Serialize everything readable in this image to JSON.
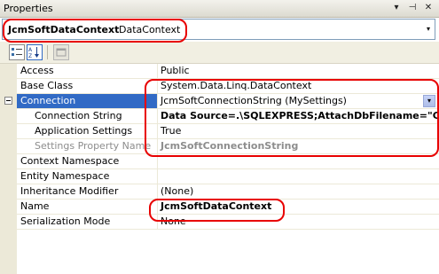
{
  "window": {
    "title": "Properties",
    "dropdown_glyph": "▾",
    "pin_glyph": "⊣",
    "close_glyph": "✕"
  },
  "object_selector": {
    "name": "JcmSoftDataContext",
    "type": "DataContext",
    "arrow_glyph": "▾"
  },
  "toolbar": {
    "buttons": [
      "categorized",
      "alphabetical",
      "property-pages"
    ]
  },
  "properties": [
    {
      "name": "Access",
      "value": "Public"
    },
    {
      "name": "Base Class",
      "value": "System.Data.Linq.DataContext"
    },
    {
      "name": "Connection",
      "value": "JcmSoftConnectionString (MySettings)",
      "expanded": true,
      "selected": true,
      "expander_glyph": "−",
      "dropdown_glyph": "▾"
    },
    {
      "name": "Connection String",
      "value": "Data Source=.\\SQLEXPRESS;AttachDbFilename=\"C:\\Do",
      "sub": true,
      "bold": true
    },
    {
      "name": "Application Settings",
      "value": "True",
      "sub": true
    },
    {
      "name": "Settings Property Name",
      "value": "JcmSoftConnectionString",
      "sub": true,
      "disabled": true,
      "bold": true
    },
    {
      "name": "Context Namespace",
      "value": ""
    },
    {
      "name": "Entity Namespace",
      "value": ""
    },
    {
      "name": "Inheritance Modifier",
      "value": "(None)"
    },
    {
      "name": "Name",
      "value": "JcmSoftDataContext",
      "bold": true
    },
    {
      "name": "Serialization Mode",
      "value": "None"
    }
  ],
  "colors": {
    "selection": "#316ac5",
    "callout": "#e80000",
    "gutter": "#ece9d8"
  }
}
